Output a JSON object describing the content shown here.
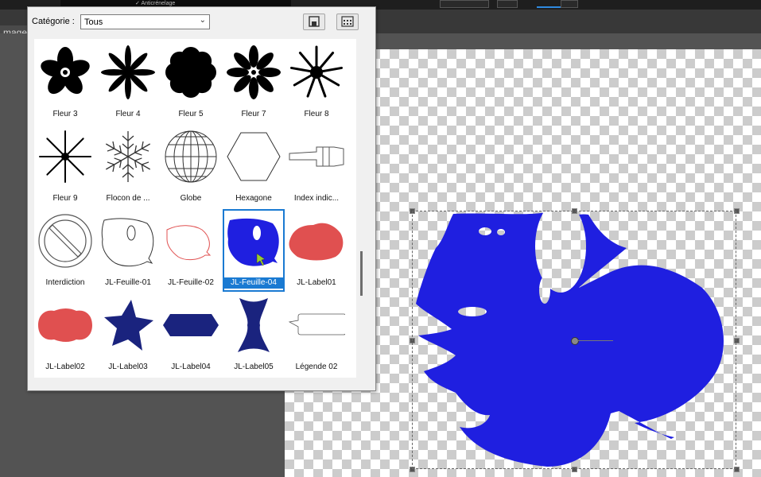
{
  "toolbar": {
    "antialias_label": "Anticrénelage"
  },
  "document_tab": {
    "label": "mage1"
  },
  "shapes_panel": {
    "category_label": "Catégorie :",
    "category_value": "Tous",
    "shapes": [
      {
        "label": "Fleur 3",
        "icon": "flower3-icon"
      },
      {
        "label": "Fleur 4",
        "icon": "flower4-icon"
      },
      {
        "label": "Fleur 5",
        "icon": "flower5-icon"
      },
      {
        "label": "Fleur 7",
        "icon": "flower7-icon"
      },
      {
        "label": "Fleur 8",
        "icon": "flower8-icon"
      },
      {
        "label": "Fleur 9",
        "icon": "flower9-icon"
      },
      {
        "label": "Flocon de ...",
        "icon": "snowflake-icon"
      },
      {
        "label": "Globe",
        "icon": "globe-icon"
      },
      {
        "label": "Hexagone",
        "icon": "hexagon-icon"
      },
      {
        "label": "Index indic...",
        "icon": "pointing-hand-icon"
      },
      {
        "label": "Interdiction",
        "icon": "prohibition-icon"
      },
      {
        "label": "JL-Feuille-01",
        "icon": "leaf-outline-icon"
      },
      {
        "label": "JL-Feuille-02",
        "icon": "leaf-red-outline-icon"
      },
      {
        "label": "JL-Feuille-04",
        "icon": "leaf-blue-icon"
      },
      {
        "label": "JL-Label01",
        "icon": "red-label-icon"
      },
      {
        "label": "JL-Label02",
        "icon": "red-oval-label-icon"
      },
      {
        "label": "JL-Label03",
        "icon": "star-icon"
      },
      {
        "label": "JL-Label04",
        "icon": "hex-label-icon"
      },
      {
        "label": "JL-Label05",
        "icon": "hourglass-label-icon"
      },
      {
        "label": "Légende 02",
        "icon": "callout-icon"
      }
    ],
    "selected_shape": "JL-Feuille-04"
  },
  "colors": {
    "shape_fill": "#1f1fe0",
    "label_red": "#e05050",
    "dark_navy": "#1a237e",
    "selection": "#1a7ad2"
  }
}
